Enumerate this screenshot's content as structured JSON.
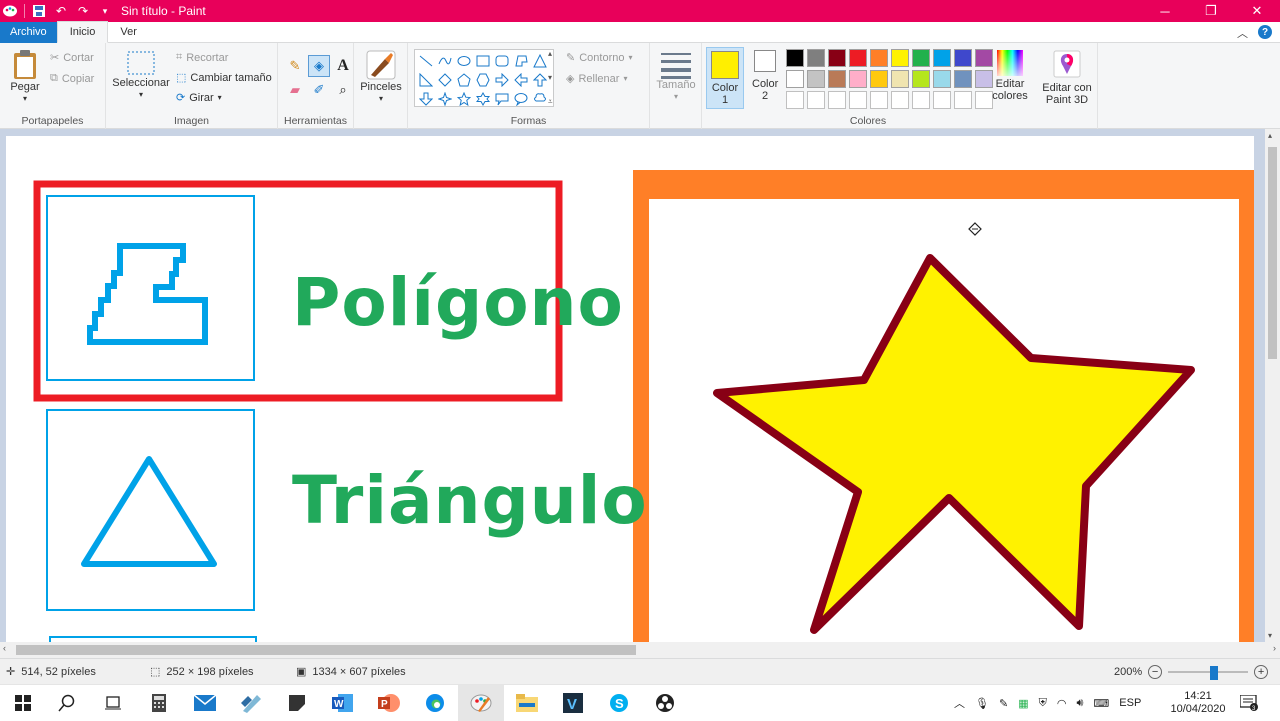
{
  "window": {
    "title": "Sin título - Paint"
  },
  "menu": {
    "file": "Archivo",
    "home": "Inicio",
    "view": "Ver"
  },
  "ribbon": {
    "clipboard": {
      "paste": "Pegar",
      "cut": "Cortar",
      "copy": "Copiar",
      "label": "Portapapeles"
    },
    "image": {
      "select": "Seleccionar",
      "crop": "Recortar",
      "resize": "Cambiar tamaño",
      "rotate": "Girar",
      "label": "Imagen"
    },
    "tools": {
      "label": "Herramientas"
    },
    "brushes": {
      "label": "Pinceles"
    },
    "shapes": {
      "outline": "Contorno",
      "fill": "Rellenar",
      "label": "Formas"
    },
    "size": {
      "label": "Tamaño"
    },
    "colors": {
      "color1": "Color 1",
      "color2": "Color 2",
      "edit": "Editar colores",
      "paint3d": "Editar con Paint 3D",
      "label": "Colores",
      "color1_value": "#ffef00",
      "color2_value": "#ffffff",
      "palette": [
        "#000000",
        "#7f7f7f",
        "#880015",
        "#ed1c24",
        "#ff7f27",
        "#fff200",
        "#22b14c",
        "#00a2e8",
        "#3f48cc",
        "#a349a4",
        "#ffffff",
        "#c3c3c3",
        "#b97a57",
        "#ffaec9",
        "#ffc90e",
        "#efe4b0",
        "#b5e61d",
        "#99d9ea",
        "#7092be",
        "#c8bfe7",
        "#ffffff",
        "#ffffff",
        "#ffffff",
        "#ffffff",
        "#ffffff",
        "#ffffff",
        "#ffffff",
        "#ffffff",
        "#ffffff",
        "#ffffff"
      ]
    }
  },
  "canvas": {
    "label1": "Polígono",
    "label2": "Triángulo"
  },
  "status": {
    "cursor": "514, 52 píxeles",
    "selection": "252 × 198 píxeles",
    "image_size": "1334 × 607 píxeles",
    "zoom": "200%"
  },
  "taskbar": {
    "lang": "ESP",
    "time": "14:21",
    "date": "10/04/2020"
  }
}
